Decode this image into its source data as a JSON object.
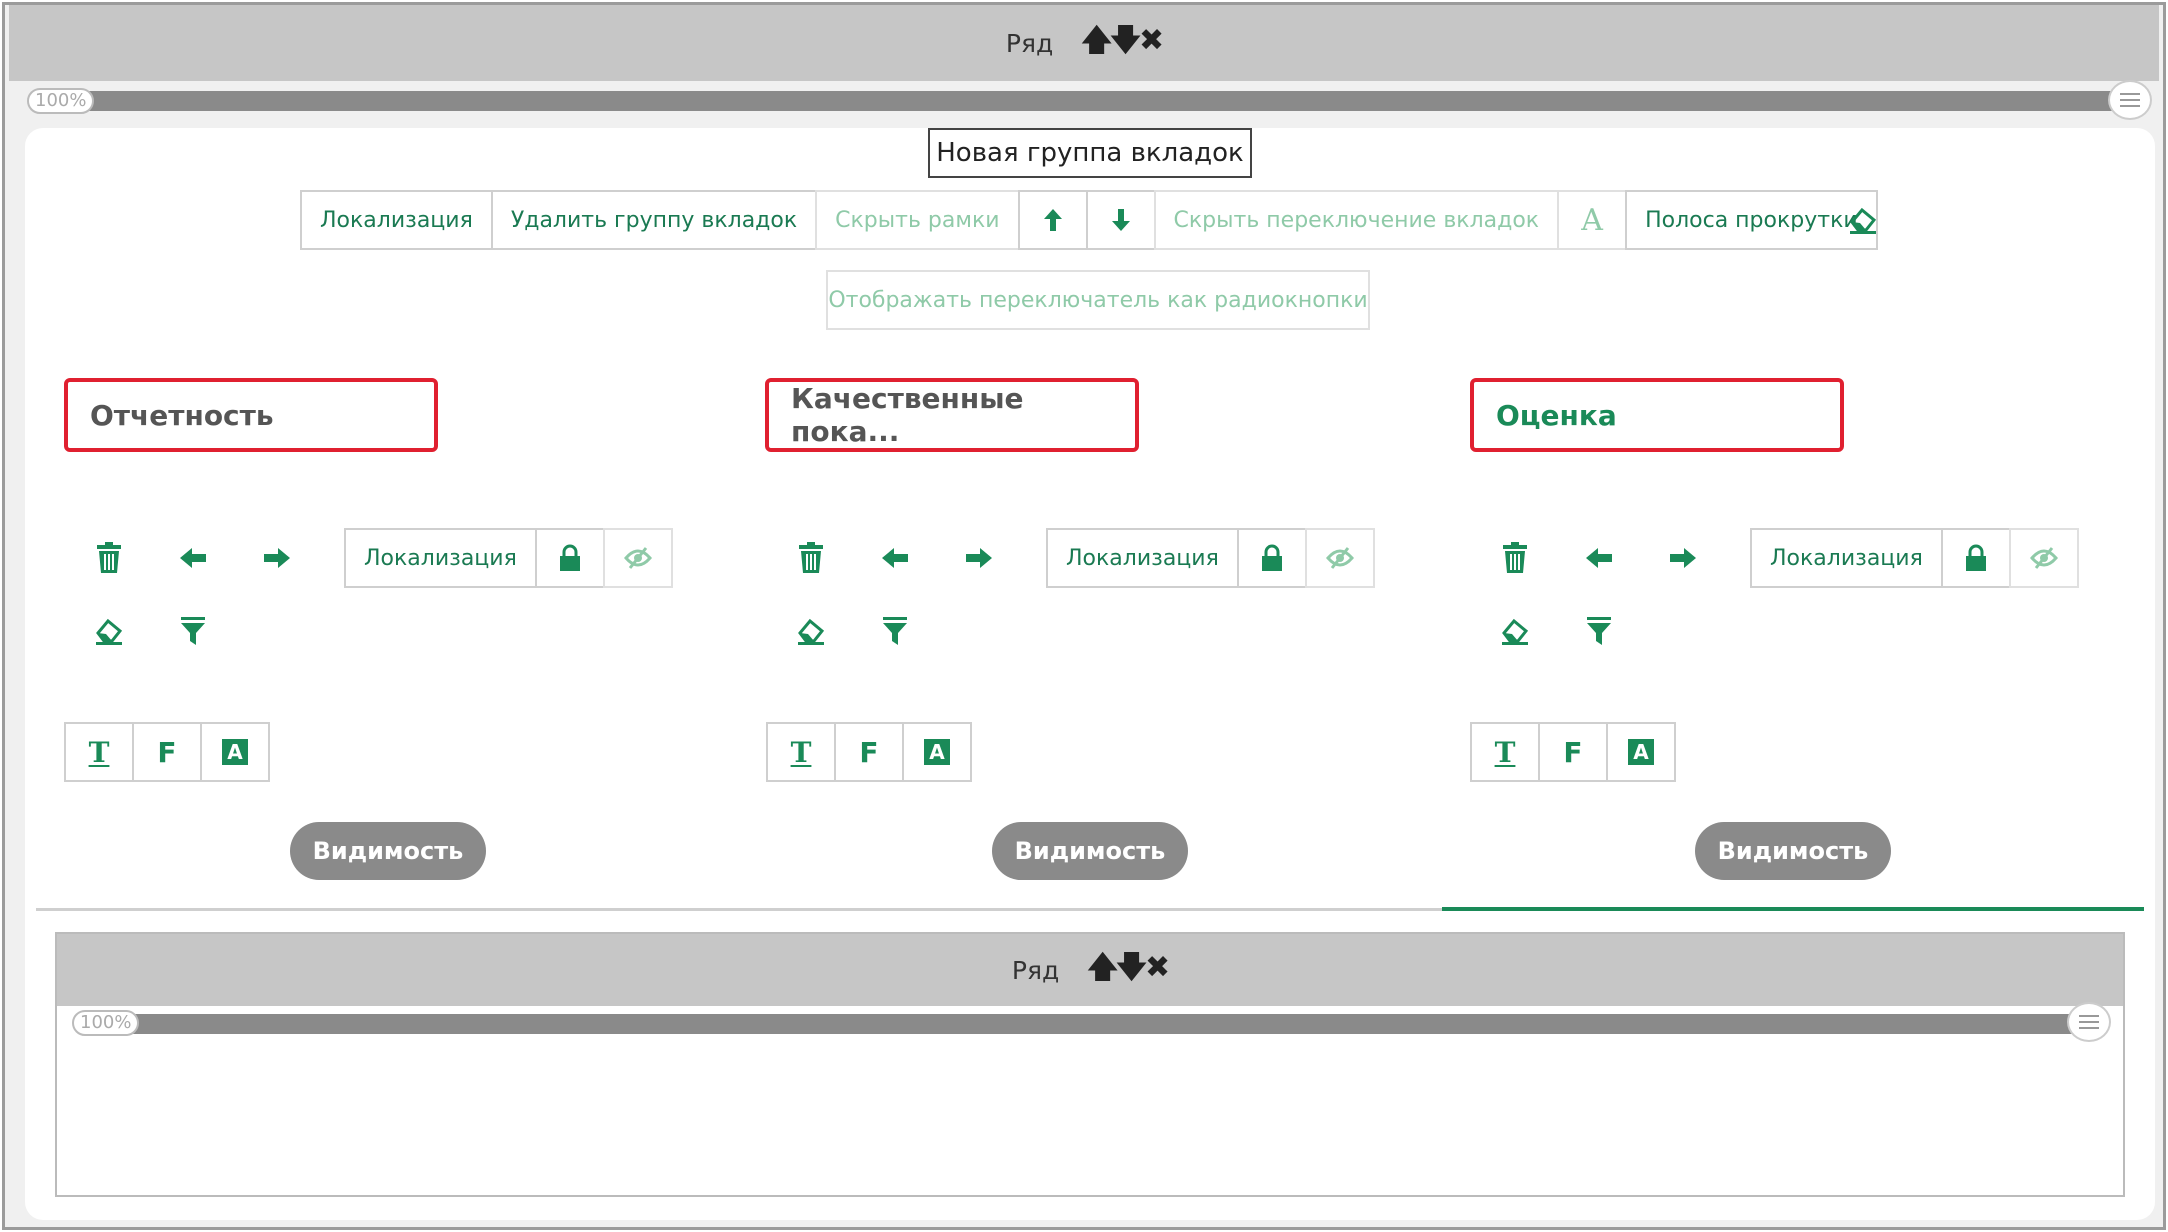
{
  "row": {
    "label": "Ряд",
    "up": "🡅",
    "down": "🡇",
    "close": "✖"
  },
  "slider": {
    "percent": "100%"
  },
  "tab_group": {
    "title": "Новая группа вкладок",
    "toolbar": {
      "localization": "Локализация",
      "delete_group": "Удалить группу вкладок",
      "hide_borders": "Скрыть рамки",
      "hide_tab_switching": "Скрыть переключение вкладок",
      "font_letter": "A",
      "scrollbar": "Полоса прокрутки",
      "show_as_radio": "Отображать переключатель как радиокнопки"
    }
  },
  "tabs": [
    {
      "name": "Отчетность",
      "localization": "Локализация",
      "visibility": "Видимость",
      "active": false
    },
    {
      "name": "Качественные пока...",
      "localization": "Локализация",
      "visibility": "Видимость",
      "active": false
    },
    {
      "name": "Оценка",
      "localization": "Локализация",
      "visibility": "Видимость",
      "active": true
    }
  ],
  "format_buttons": {
    "text": "T",
    "formula": "F",
    "style": "A"
  },
  "inner_row": {
    "label": "Ряд",
    "percent": "100%"
  },
  "colors": {
    "accent": "#1a8a58",
    "highlight": "#e02030",
    "bar": "#c6c6c6"
  }
}
